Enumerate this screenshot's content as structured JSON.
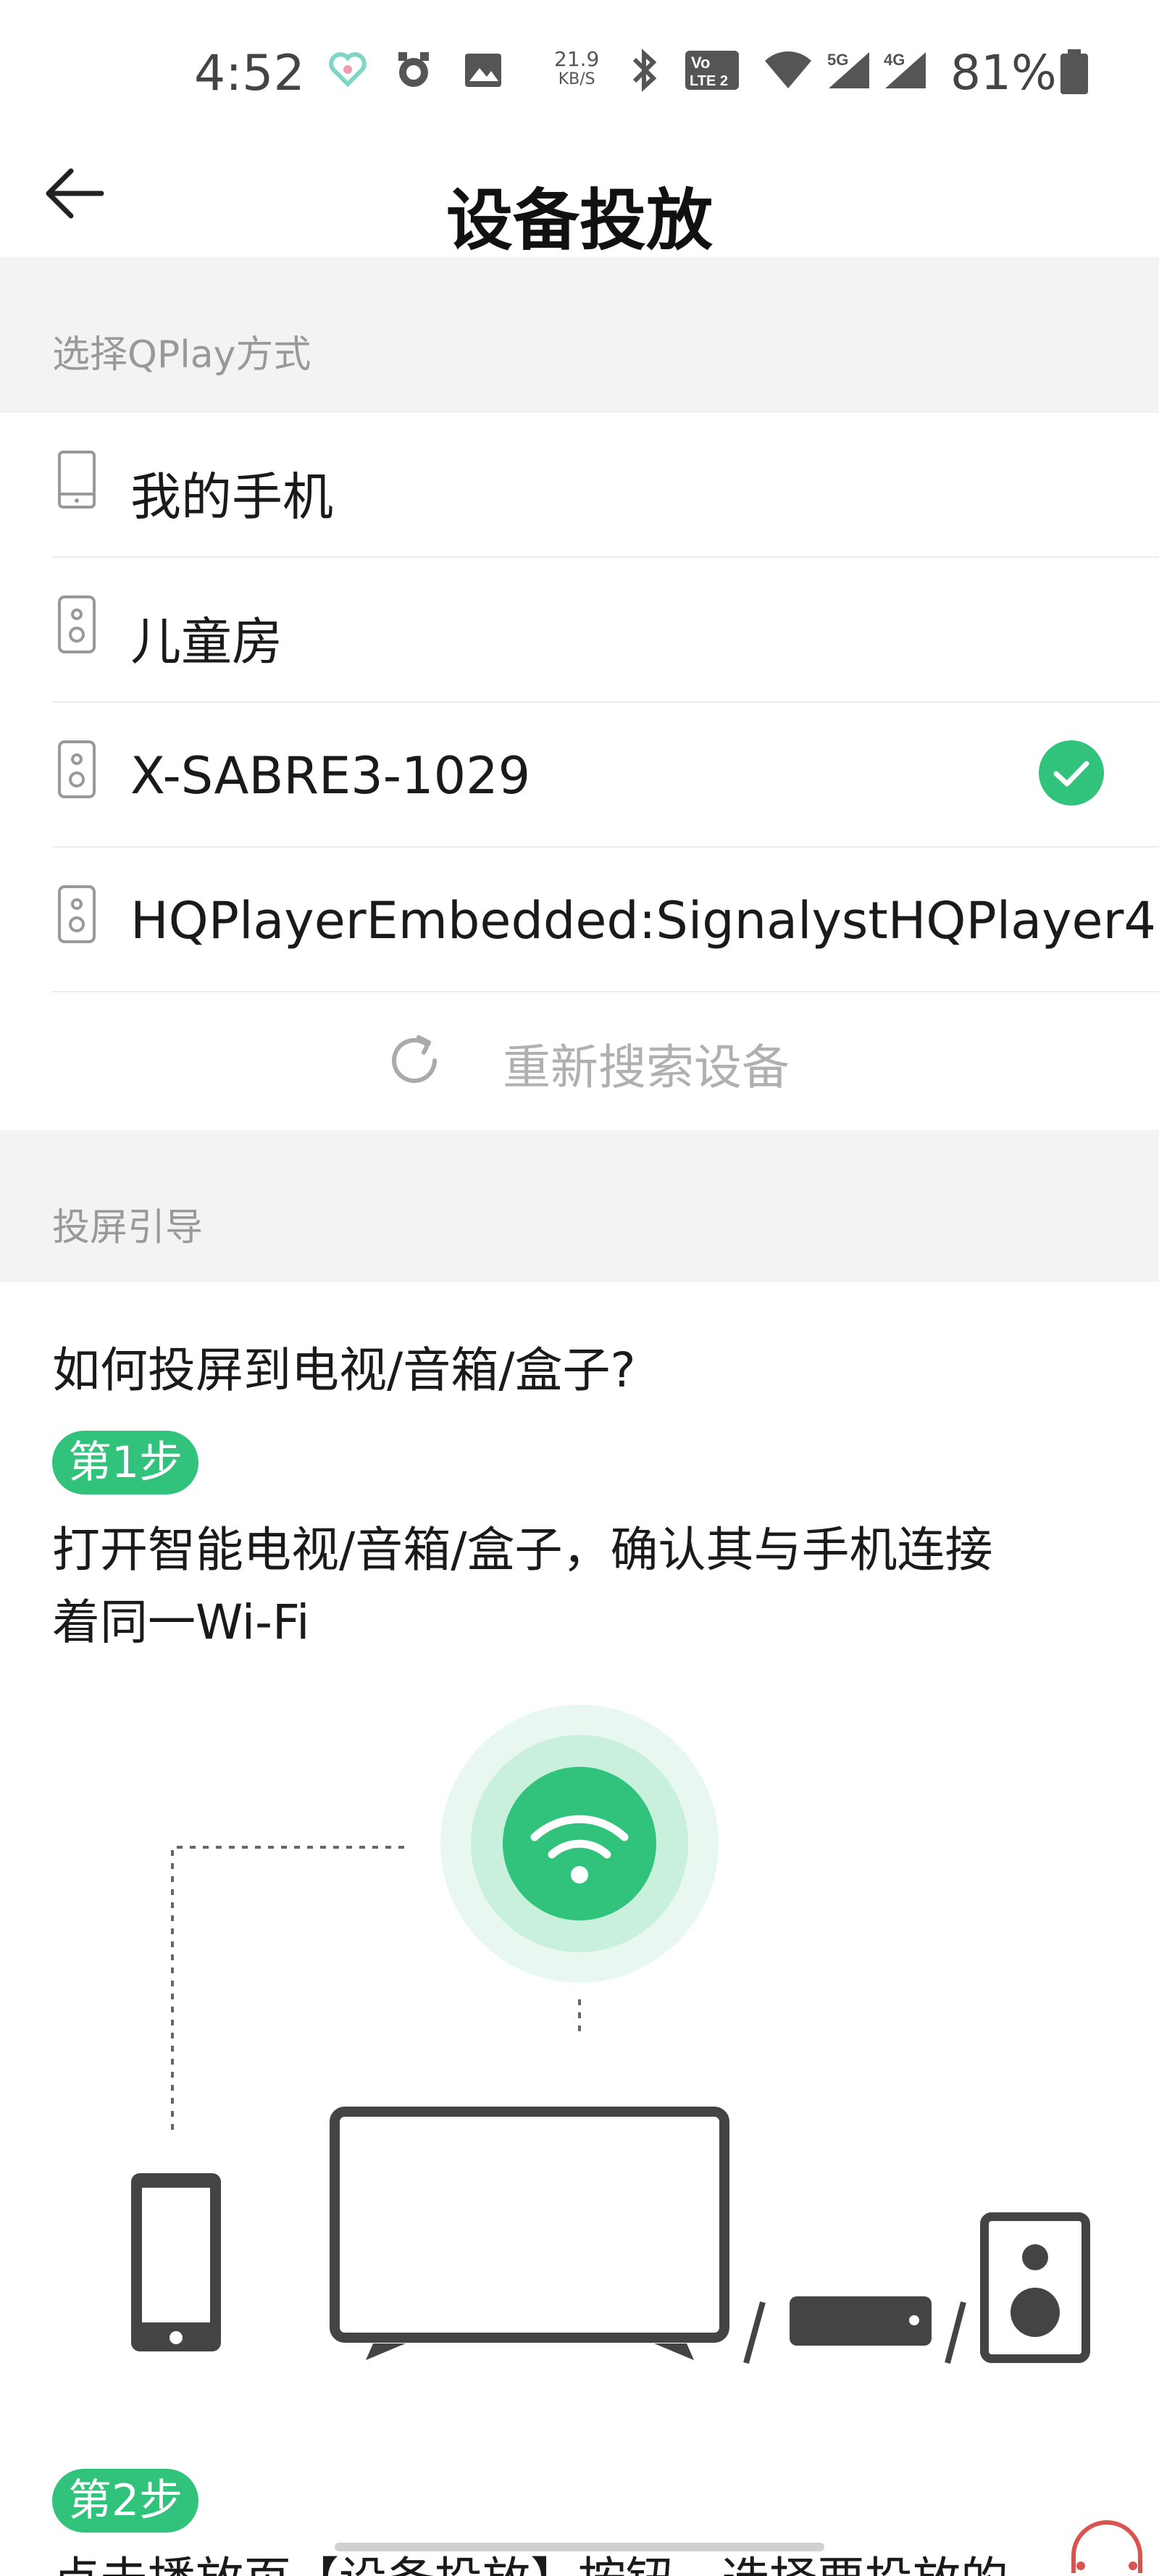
{
  "status_bar": {
    "time": "4:52",
    "net_speed_value": "21.9",
    "net_speed_unit": "KB/S",
    "volte_label_top": "Vo",
    "volte_label_bottom": "LTE 2",
    "signal1_label": "5G",
    "signal2_label": "4G",
    "battery": "81%"
  },
  "header": {
    "title": "设备投放"
  },
  "qplay_section": {
    "label": "选择QPlay方式",
    "devices": [
      {
        "name": "我的手机",
        "icon": "phone-icon",
        "selected": false
      },
      {
        "name": "儿童房",
        "icon": "speaker-icon",
        "selected": false
      },
      {
        "name": "X-SABRE3-1029",
        "icon": "speaker-icon",
        "selected": true
      },
      {
        "name": "HQPlayerEmbedded:SignalystHQPlayer4",
        "icon": "speaker-icon",
        "selected": false
      }
    ],
    "refresh_label": "重新搜索设备"
  },
  "guide_section": {
    "label": "投屏引导",
    "question": "如何投屏到电视/音箱/盒子?",
    "steps": [
      {
        "badge": "第1步",
        "text_line1": "打开智能电视/音箱/盒子，确认其与手机连接",
        "text_line2": "着同一Wi-Fi"
      },
      {
        "badge": "第2步",
        "text_line1": "点击播放页【设备投放】按钮，选择要投放的"
      }
    ]
  },
  "colors": {
    "accent_green": "#31c27c",
    "section_bg": "#f3f3f3"
  }
}
